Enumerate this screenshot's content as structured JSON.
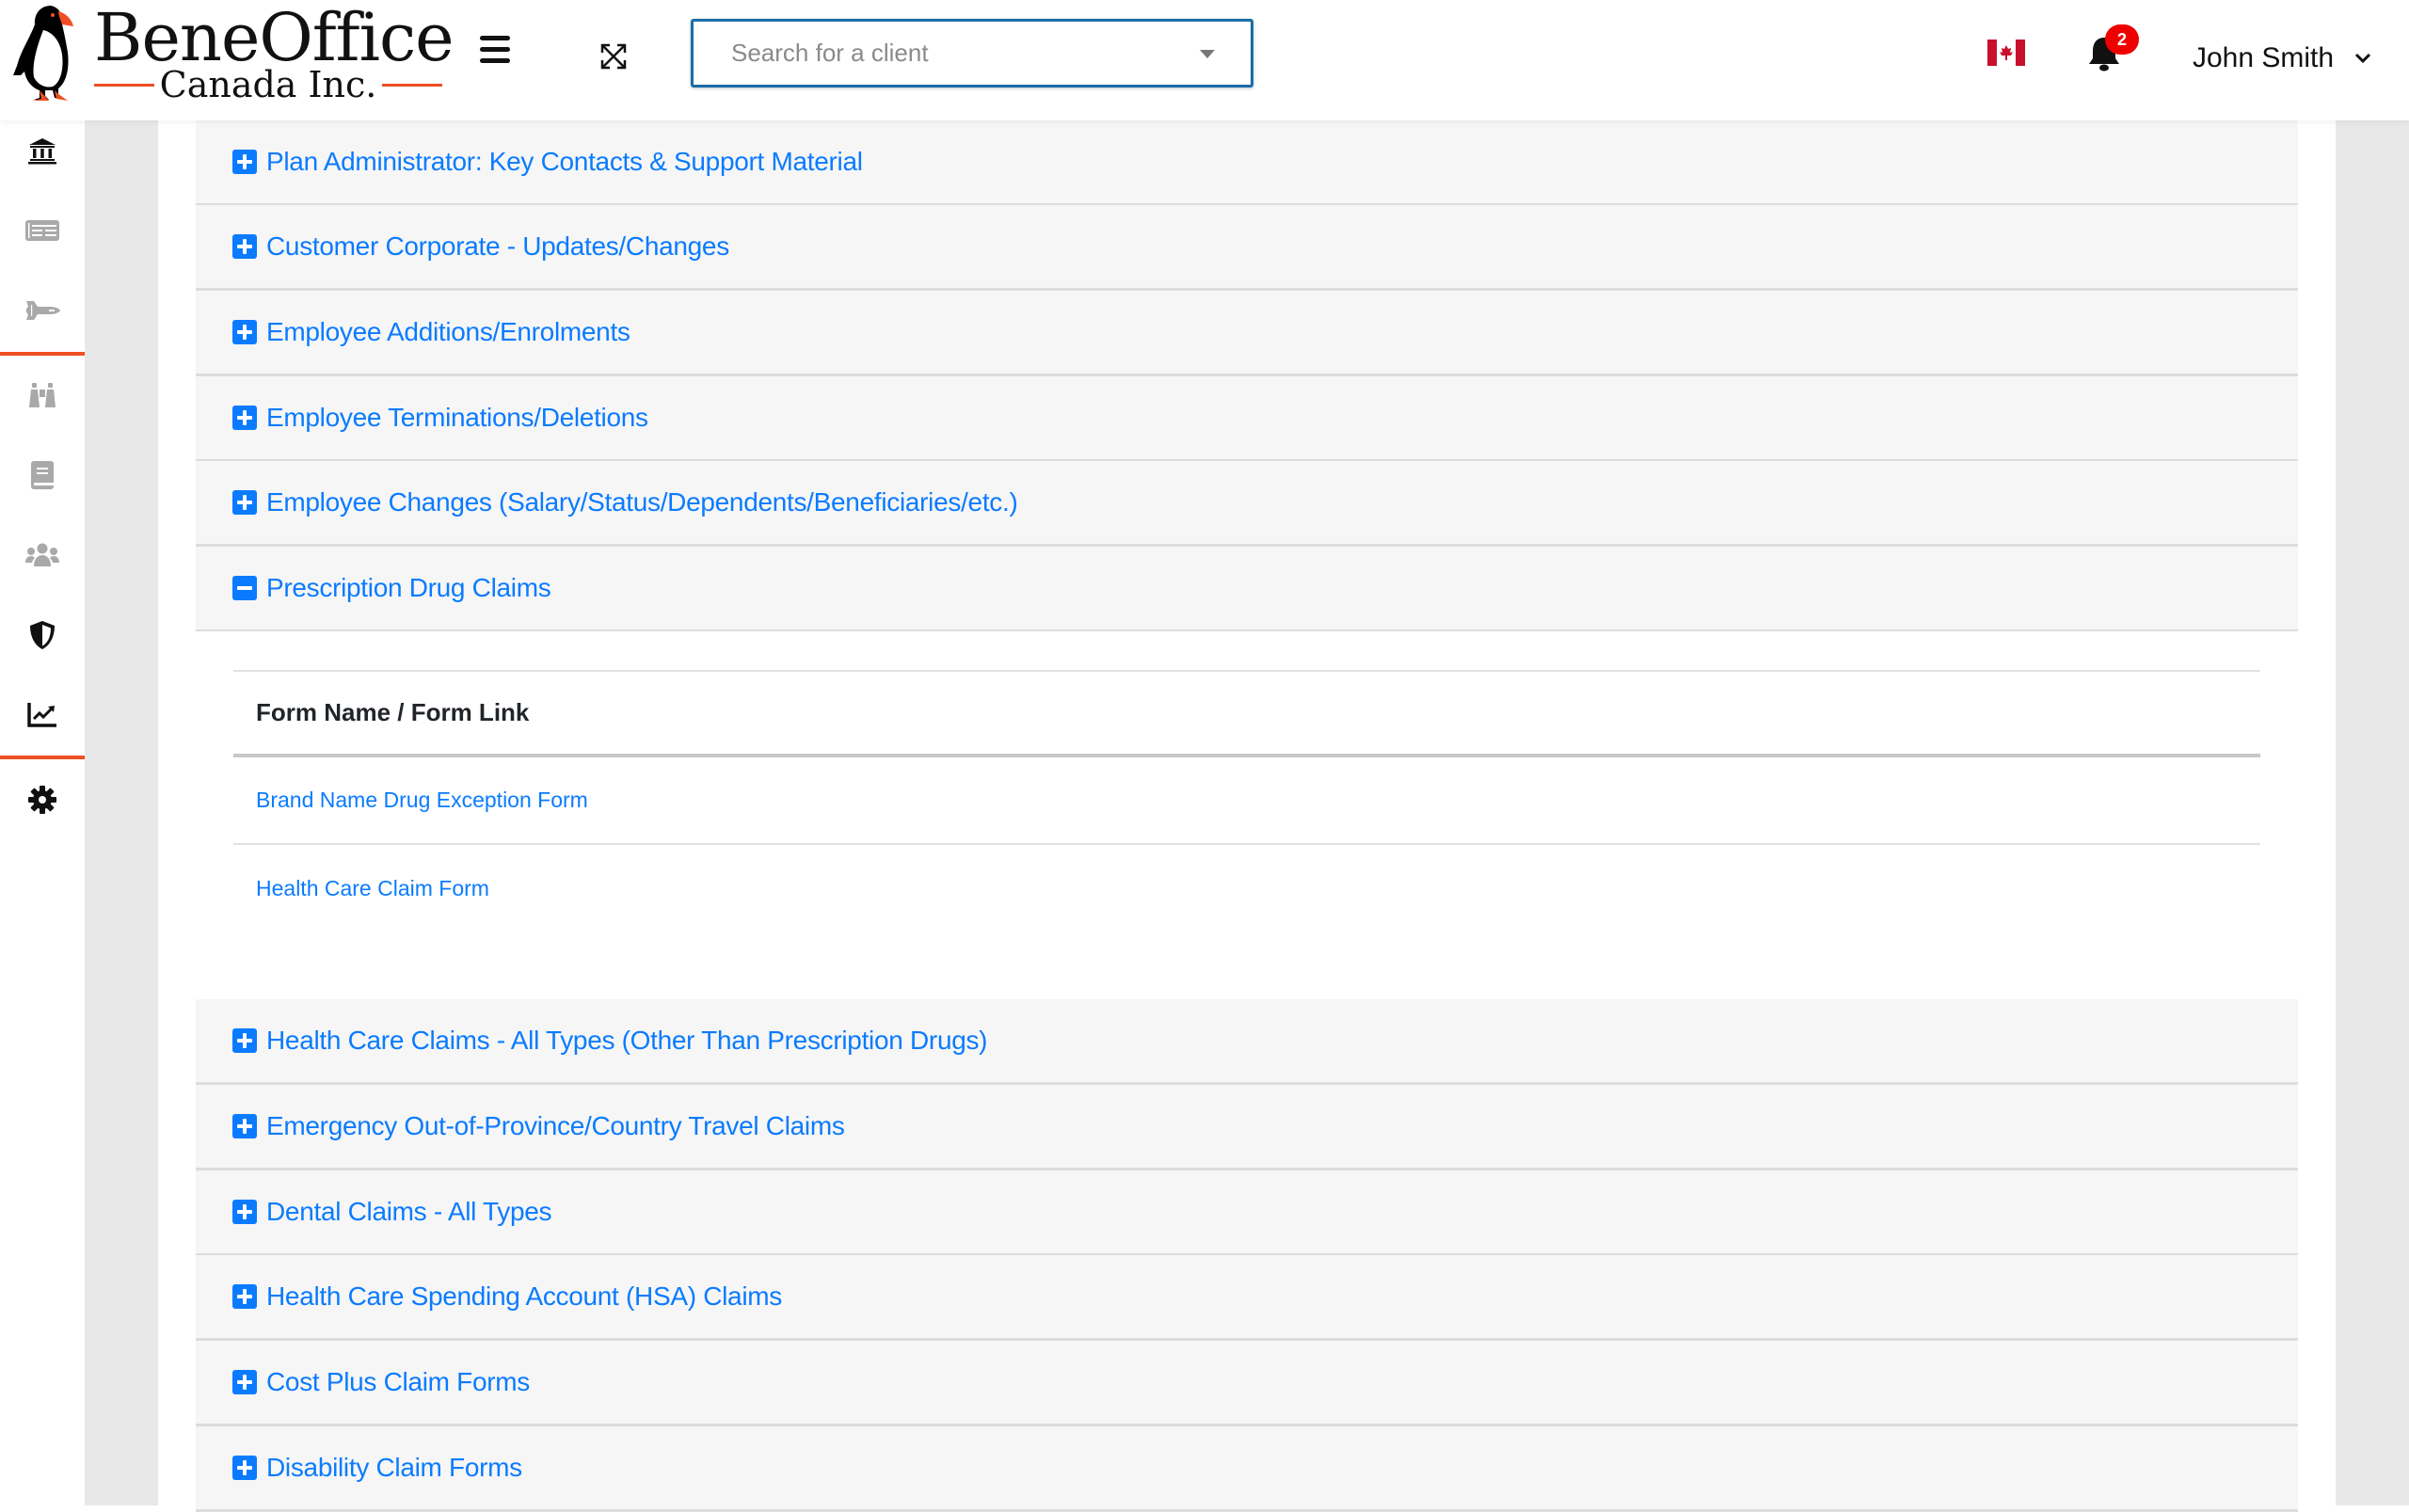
{
  "header": {
    "logo": {
      "title": "BeneOffice",
      "subtitle": "Canada Inc."
    },
    "search": {
      "placeholder": "Search for a client",
      "value": ""
    },
    "notifications": {
      "count": "2"
    },
    "user": {
      "name": "John Smith"
    },
    "language_flag": "canada-flag-icon"
  },
  "sidebar": {
    "items": [
      {
        "icon": "bank-icon",
        "active": true
      },
      {
        "icon": "newspaper-icon",
        "active": false
      },
      {
        "icon": "space-shuttle-icon",
        "active": false
      },
      {
        "icon": "binoculars-icon",
        "active": false
      },
      {
        "icon": "book-icon",
        "active": false
      },
      {
        "icon": "users-icon",
        "active": false
      },
      {
        "icon": "shield-icon",
        "active": true
      },
      {
        "icon": "chart-line-icon",
        "active": true
      },
      {
        "icon": "gear-icon",
        "active": true
      }
    ]
  },
  "accordion": {
    "sections": [
      {
        "label": "Plan Administrator: Key Contacts & Support Material",
        "expanded": false
      },
      {
        "label": "Customer Corporate - Updates/Changes",
        "expanded": false
      },
      {
        "label": "Employee Additions/Enrolments",
        "expanded": false
      },
      {
        "label": "Employee Terminations/Deletions",
        "expanded": false
      },
      {
        "label": "Employee Changes (Salary/Status/Dependents/Beneficiaries/etc.)",
        "expanded": false
      },
      {
        "label": "Prescription Drug Claims",
        "expanded": true
      },
      {
        "label": "Health Care Claims - All Types (Other Than Prescription Drugs)",
        "expanded": false
      },
      {
        "label": "Emergency Out-of-Province/Country Travel Claims",
        "expanded": false
      },
      {
        "label": "Dental Claims - All Types",
        "expanded": false
      },
      {
        "label": "Health Care Spending Account (HSA) Claims",
        "expanded": false
      },
      {
        "label": "Cost Plus Claim Forms",
        "expanded": false
      },
      {
        "label": "Disability Claim Forms",
        "expanded": false
      }
    ],
    "expanded_table": {
      "column_header": "Form Name / Form Link",
      "rows": [
        "Brand Name Drug Exception Form",
        "Health Care Claim Form"
      ]
    }
  },
  "colors": {
    "link_blue": "#0a7bff",
    "accent_orange": "#f04e23",
    "badge_red": "#ee0000",
    "search_border": "#1b6ea8"
  }
}
